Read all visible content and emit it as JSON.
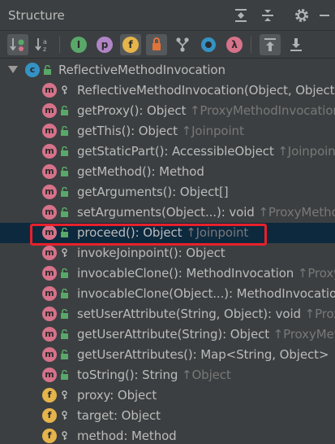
{
  "panel": {
    "title": "Structure"
  },
  "toolbar": {
    "buttons": [
      {
        "icon": "sort-by-visibility-icon",
        "active": true
      },
      {
        "icon": "sort-alphabetically-icon",
        "active": false
      },
      {
        "icon": "show-inherited-icon",
        "label": "I"
      },
      {
        "icon": "show-properties-icon",
        "label": "p"
      },
      {
        "icon": "show-fields-icon",
        "label": "f"
      },
      {
        "icon": "show-non-public-icon"
      },
      {
        "icon": "show-hierarchy-icon"
      },
      {
        "icon": "show-anonymous-icon"
      },
      {
        "icon": "show-lambdas-icon",
        "label": "λ"
      },
      {
        "icon": "autoscroll-to-source-icon",
        "active": true
      },
      {
        "icon": "autoscroll-from-source-icon"
      }
    ],
    "labels": {
      "inherited": "I",
      "properties": "p",
      "fields": "f",
      "lambdas": "λ"
    }
  },
  "tree": {
    "root": {
      "label": "ReflectiveMethodInvocation",
      "icon_letter": "c"
    },
    "items": [
      {
        "kind": "m",
        "visibility": "protected",
        "name": "ReflectiveMethodInvocation(Object, Object",
        "super": ""
      },
      {
        "kind": "m",
        "visibility": "public",
        "name": "getProxy(): Object ",
        "super": "↑ProxyMethodInvocation"
      },
      {
        "kind": "m",
        "visibility": "public",
        "name": "getThis(): Object ",
        "super": "↑Joinpoint"
      },
      {
        "kind": "m",
        "visibility": "public",
        "name": "getStaticPart(): AccessibleObject ",
        "super": "↑Joinpoint"
      },
      {
        "kind": "m",
        "visibility": "public",
        "name": "getMethod(): Method",
        "super": ""
      },
      {
        "kind": "m",
        "visibility": "public",
        "name": "getArguments(): Object[]",
        "super": ""
      },
      {
        "kind": "m",
        "visibility": "public",
        "name": "setArguments(Object...): void ",
        "super": "↑ProxyMethod"
      },
      {
        "kind": "m",
        "visibility": "public",
        "name": "proceed(): Object ",
        "super": "↑Joinpoint",
        "selected": true
      },
      {
        "kind": "m",
        "visibility": "protected",
        "name": "invokeJoinpoint(): Object",
        "super": ""
      },
      {
        "kind": "m",
        "visibility": "public",
        "name": "invocableClone(): MethodInvocation ",
        "super": "↑Proxy"
      },
      {
        "kind": "m",
        "visibility": "public",
        "name": "invocableClone(Object...): MethodInvocatio",
        "super": ""
      },
      {
        "kind": "m",
        "visibility": "public",
        "name": "setUserAttribute(String, Object): void ",
        "super": "↑Prox"
      },
      {
        "kind": "m",
        "visibility": "public",
        "name": "getUserAttribute(String): Object ",
        "super": "↑ProxyMet"
      },
      {
        "kind": "m",
        "visibility": "public",
        "name": "getUserAttributes(): Map<String, Object>",
        "super": ""
      },
      {
        "kind": "m",
        "visibility": "public",
        "name": "toString(): String ",
        "super": "↑Object"
      },
      {
        "kind": "f",
        "visibility": "protected",
        "name": "proxy: Object",
        "super": ""
      },
      {
        "kind": "f",
        "visibility": "protected",
        "name": "target: Object",
        "super": ""
      },
      {
        "kind": "f",
        "visibility": "protected",
        "name": "method: Method",
        "super": ""
      }
    ]
  },
  "colors": {
    "background": "#3c3f41",
    "selection": "#0d293e",
    "method_icon": "#d6728a",
    "field_icon": "#e5b44b",
    "class_icon": "#3592c4",
    "public_lock": "#59a869",
    "highlight_border": "#e8212b"
  }
}
